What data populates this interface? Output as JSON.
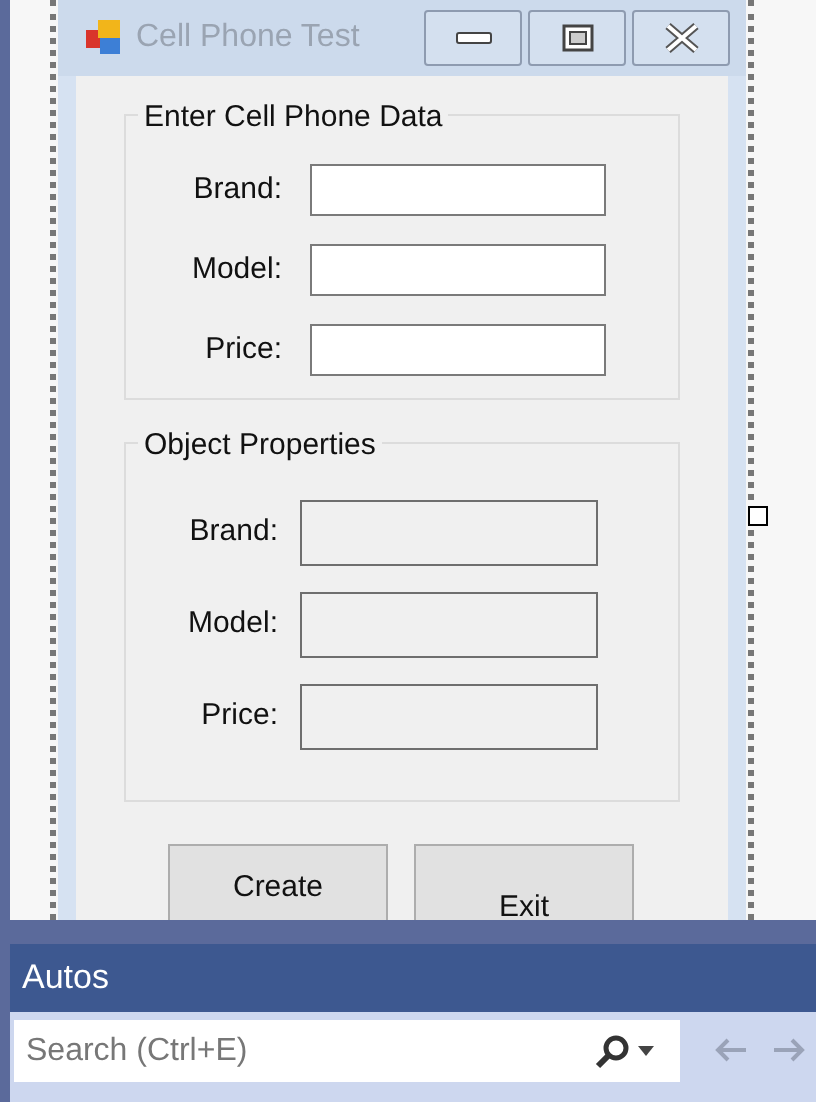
{
  "form": {
    "title": "Cell Phone Test",
    "input_group": {
      "title": "Enter Cell Phone Data",
      "fields": [
        {
          "label": "Brand:"
        },
        {
          "label": "Model:"
        },
        {
          "label": "Price:"
        }
      ]
    },
    "output_group": {
      "title": "Object Properties",
      "fields": [
        {
          "label": "Brand:"
        },
        {
          "label": "Model:"
        },
        {
          "label": "Price:"
        }
      ]
    },
    "buttons": [
      "Create",
      "Exit"
    ]
  },
  "autos_panel": {
    "title": "Autos",
    "search": {
      "placeholder": "Search (Ctrl+E)"
    }
  }
}
